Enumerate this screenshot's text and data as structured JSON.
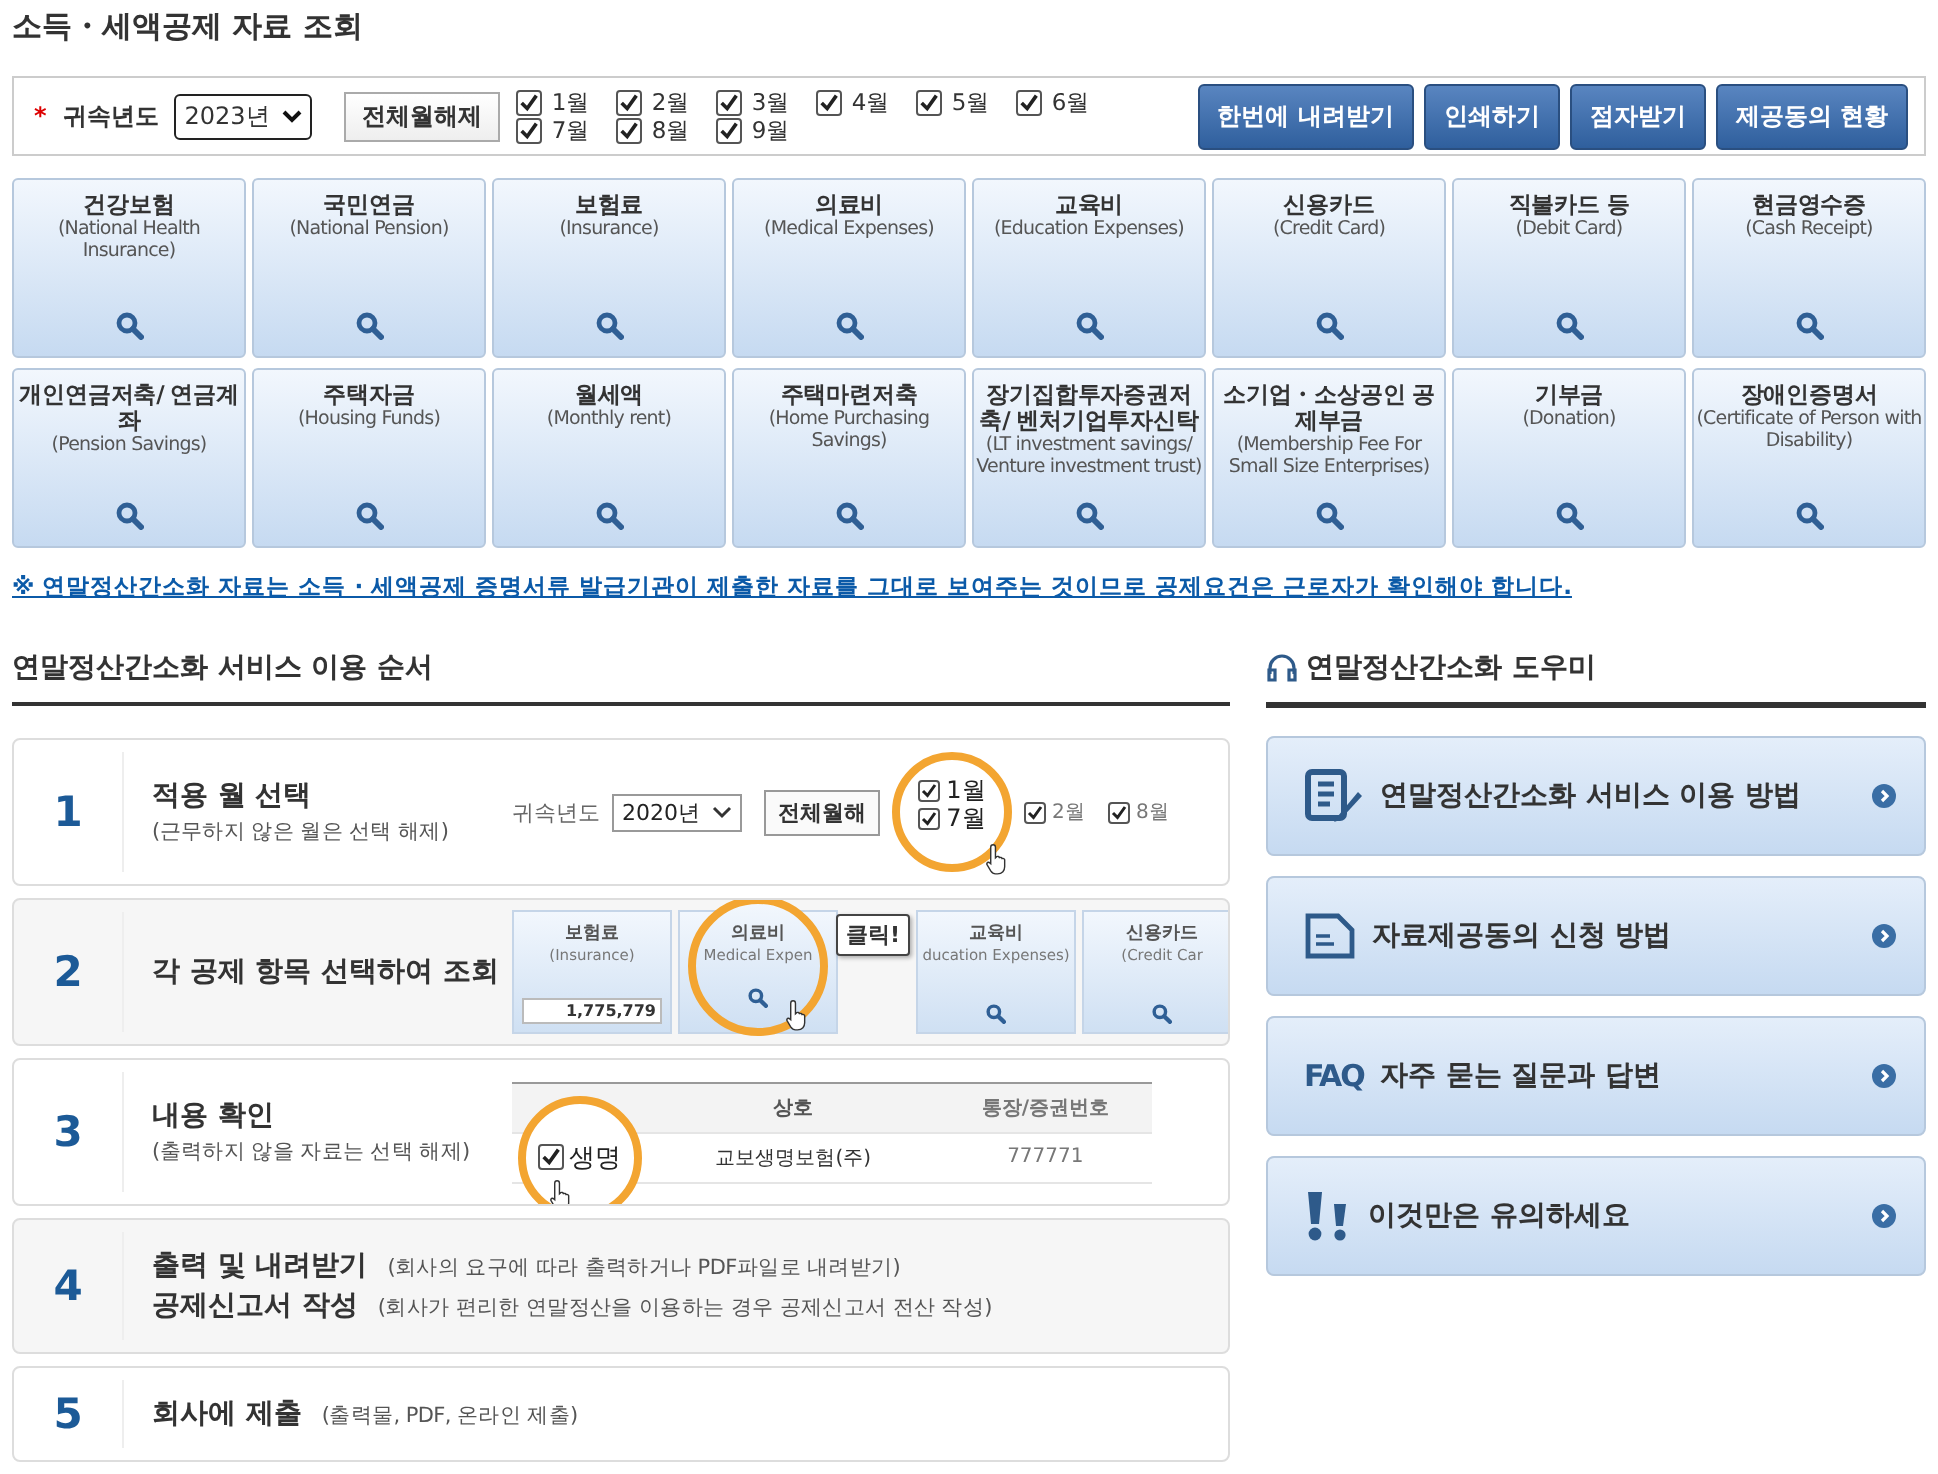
{
  "page_title": "소득・세액공제 자료 조회",
  "filter": {
    "required_mark": "*",
    "year_label": "귀속년도",
    "year_value": "2023년",
    "clear_button": "전체월해제",
    "months": [
      {
        "label": "1월",
        "checked": true
      },
      {
        "label": "2월",
        "checked": true
      },
      {
        "label": "3월",
        "checked": true
      },
      {
        "label": "4월",
        "checked": true
      },
      {
        "label": "5월",
        "checked": true
      },
      {
        "label": "6월",
        "checked": true
      },
      {
        "label": "7월",
        "checked": true
      },
      {
        "label": "8월",
        "checked": true
      },
      {
        "label": "9월",
        "checked": true
      }
    ],
    "actions": [
      "한번에 내려받기",
      "인쇄하기",
      "점자받기",
      "제공동의 현황"
    ]
  },
  "categories": [
    {
      "title": "건강보험",
      "subtitle": "(National Health Insurance)"
    },
    {
      "title": "국민연금",
      "subtitle": "(National Pension)"
    },
    {
      "title": "보험료",
      "subtitle": "(Insurance)"
    },
    {
      "title": "의료비",
      "subtitle": "(Medical Expenses)"
    },
    {
      "title": "교육비",
      "subtitle": "(Education Expenses)"
    },
    {
      "title": "신용카드",
      "subtitle": "(Credit Card)"
    },
    {
      "title": "직불카드 등",
      "subtitle": "(Debit Card)"
    },
    {
      "title": "현금영수증",
      "subtitle": "(Cash Receipt)"
    },
    {
      "title": "개인연금저축/ 연금계좌",
      "subtitle": "(Pension Savings)"
    },
    {
      "title": "주택자금",
      "subtitle": "(Housing Funds)"
    },
    {
      "title": "월세액",
      "subtitle": "(Monthly rent)"
    },
    {
      "title": "주택마련저축",
      "subtitle": "(Home Purchasing Savings)"
    },
    {
      "title": "장기집합투자증권저축/ 벤처기업투자신탁",
      "subtitle": "(LT investment savings/ Venture investment trust)"
    },
    {
      "title": "소기업・소상공인 공제부금",
      "subtitle": "(Membership Fee For Small Size Enterprises)"
    },
    {
      "title": "기부금",
      "subtitle": "(Donation)"
    },
    {
      "title": "장애인증명서",
      "subtitle": "(Certificate of Person with Disability)"
    }
  ],
  "notice": "※ 연말정산간소화 자료는 소득 · 세액공제 증명서류 발급기관이 제출한 자료를 그대로 보여주는 것이므로 공제요건은 근로자가 확인해야 합니다.",
  "guide": {
    "title": "연말정산간소화 서비스 이용 순서",
    "steps": [
      {
        "number": "1",
        "kind": "stacked",
        "lines": [
          {
            "title": "적용 월 선택",
            "note": "(근무하지 않은 월은 선택 해제)"
          }
        ],
        "illustration": {
          "kind": "months",
          "year_label": "귀속년도",
          "year_value": "2020년",
          "clear_button": "전체월해",
          "months": [
            {
              "label": "1월",
              "checked": true,
              "magnified": true
            },
            {
              "label": "7월",
              "checked": true,
              "magnified": true
            },
            {
              "label": "2월",
              "checked": true,
              "magnified": false
            },
            {
              "label": "8월",
              "checked": true,
              "magnified": false
            }
          ]
        }
      },
      {
        "number": "2",
        "kind": "stacked",
        "lines": [
          {
            "title": "각 공제 항목 선택하여 조회"
          }
        ],
        "illustration": {
          "kind": "tiles",
          "tooltip": "클릭!",
          "tiles": [
            {
              "title": "보험료",
              "subtitle": "(Insurance)",
              "amount": "1,775,779",
              "magnified": false
            },
            {
              "title": "의료비",
              "subtitle": "Medical Expen",
              "magnified": true
            },
            {
              "title": "교육비",
              "subtitle": "ducation Expenses)",
              "magnified": false
            },
            {
              "title": "신용카드",
              "subtitle": "(Credit Car",
              "magnified": false
            }
          ]
        }
      },
      {
        "number": "3",
        "kind": "stacked",
        "lines": [
          {
            "title": "내용 확인",
            "note": "(출력하지 않을 자료는 선택 해제)"
          }
        ],
        "illustration": {
          "kind": "table",
          "columns": [
            "상호",
            "통장/증권번호"
          ],
          "magnified_text": "생명",
          "rows": [
            {
              "checked": true,
              "cells": [
                "교보생명보험(주)",
                "777771"
              ]
            }
          ]
        }
      },
      {
        "number": "4",
        "kind": "inline",
        "lines": [
          {
            "title": "출력 및 내려받기",
            "note": "(회사의 요구에 따라 출력하거나 PDF파일로 내려받기)"
          },
          {
            "title": "공제신고서 작성",
            "note": "(회사가 편리한 연말정산을 이용하는 경우 공제신고서 전산 작성)"
          }
        ]
      },
      {
        "number": "5",
        "kind": "inline",
        "lines": [
          {
            "title": "회사에 제출",
            "note": "(출력물, PDF, 온라인 제출)"
          }
        ]
      }
    ]
  },
  "help": {
    "title": "연말정산간소화 도우미",
    "items": [
      {
        "kind": "edit",
        "label": "연말정산간소화 서비스 이용 방법"
      },
      {
        "kind": "document",
        "label": "자료제공동의 신청 방법"
      },
      {
        "kind": "faq",
        "icon_text": "FAQ",
        "label": "자주 묻는 질문과 답변"
      },
      {
        "kind": "alert",
        "label": "이것만은 유의하세요"
      }
    ]
  }
}
